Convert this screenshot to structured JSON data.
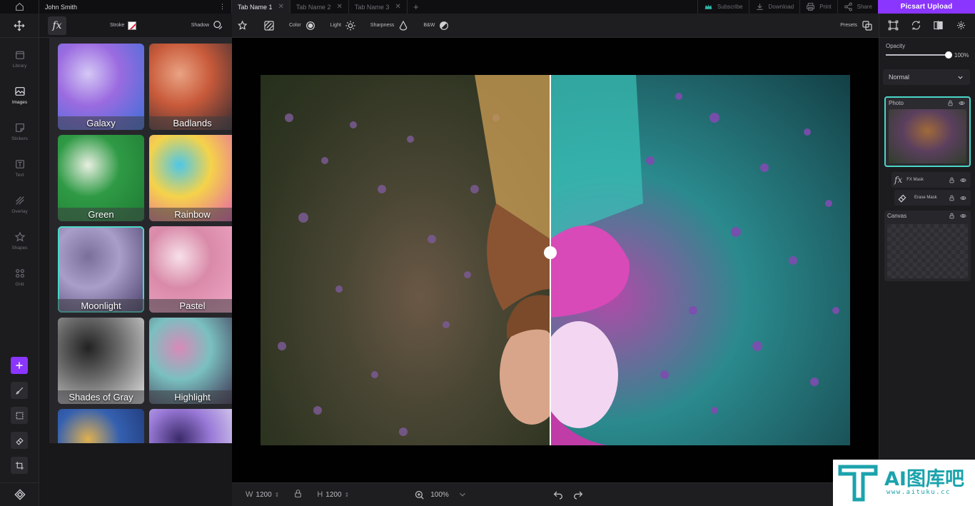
{
  "user": {
    "name": "John Smith",
    "more": "⋮"
  },
  "tabs": [
    {
      "label": "Tab Name 1",
      "active": true
    },
    {
      "label": "Tab Name 2",
      "active": false
    },
    {
      "label": "Tab Name 3",
      "active": false
    }
  ],
  "top_actions": {
    "subscribe": "Subscribe",
    "download": "Download",
    "print": "Print",
    "share": "Share",
    "upload": "Picsart Upload"
  },
  "left_rail": [
    {
      "label": "Library",
      "icon": "library-icon",
      "active": false
    },
    {
      "label": "Images",
      "icon": "images-icon",
      "active": true
    },
    {
      "label": "Stickers",
      "icon": "stickers-icon",
      "active": false
    },
    {
      "label": "Text",
      "icon": "text-icon",
      "active": false
    },
    {
      "label": "Overlay",
      "icon": "overlay-icon",
      "active": false
    },
    {
      "label": "Shapes",
      "icon": "shapes-icon",
      "active": false
    },
    {
      "label": "Grid",
      "icon": "grid-icon",
      "active": false
    }
  ],
  "effects_panel": {
    "fx": "fx",
    "stroke_label": "Stroke",
    "shadow_label": "Shadow",
    "effects": [
      {
        "label": "Galaxy",
        "colors": [
          "#3b6fd8",
          "#9b6be0",
          "#d4c8f5"
        ],
        "selected": false
      },
      {
        "label": "Badlands",
        "colors": [
          "#2b2730",
          "#c85a3a",
          "#e9a383"
        ],
        "selected": false
      },
      {
        "label": "Green",
        "colors": [
          "#1e7a33",
          "#2f9a45",
          "#e8efe2"
        ],
        "selected": false
      },
      {
        "label": "Rainbow",
        "colors": [
          "#e65ab0",
          "#f5d34a",
          "#4ec7e8"
        ],
        "selected": false
      },
      {
        "label": "Moonlight",
        "colors": [
          "#4a3d6a",
          "#a89ec9",
          "#7a6f9a"
        ],
        "selected": true
      },
      {
        "label": "Pastel",
        "colors": [
          "#f2a8c8",
          "#d98aa8",
          "#f7e0e8"
        ],
        "selected": false
      },
      {
        "label": "Shades of Gray",
        "colors": [
          "#e0e0e0",
          "#6a6a6a",
          "#222222"
        ],
        "selected": false
      },
      {
        "label": "Highlight",
        "colors": [
          "#3a2a4a",
          "#7ac0c0",
          "#d88ab8"
        ],
        "selected": false
      },
      {
        "label": "",
        "colors": [
          "#1c2f6a",
          "#3460b0",
          "#e0b050"
        ],
        "selected": false
      },
      {
        "label": "",
        "colors": [
          "#f0f0f5",
          "#9a7ad8",
          "#3a2a6a"
        ],
        "selected": false
      }
    ]
  },
  "toolbar": {
    "color_label": "Color",
    "light_label": "Light",
    "sharpness_label": "Sharpness",
    "bw_label": "B&W",
    "presets_label": "Presets"
  },
  "bottom_bar": {
    "w_key": "W",
    "w_value": "1200",
    "h_key": "H",
    "h_value": "1200",
    "zoom": "100%"
  },
  "right_panel": {
    "opacity_label": "Opacity",
    "opacity_value": "100%",
    "opacity_level": 1.0,
    "blend_mode": "Normal",
    "layers": {
      "photo": "Photo",
      "fx_mask": "FX Mask",
      "erase_mask": "Erase Mask",
      "canvas": "Canvas"
    }
  },
  "watermark": {
    "title": "AI图库吧",
    "url": "www.aituku.cc"
  },
  "accent_color": "#8a36ff",
  "selection_color": "#4ad7c8"
}
